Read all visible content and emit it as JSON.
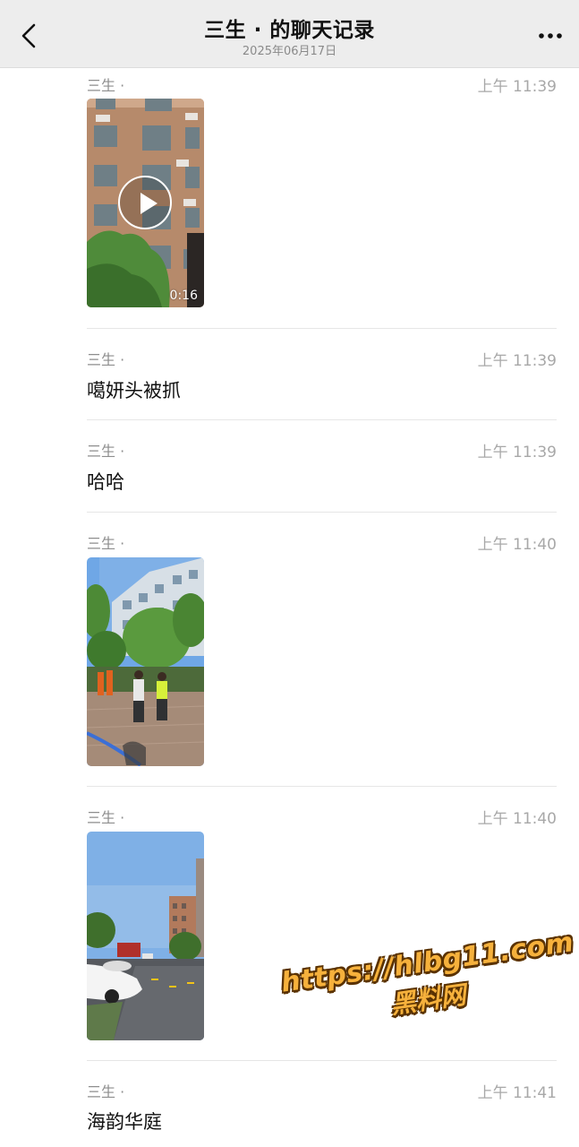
{
  "header": {
    "title": "三生 · 的聊天记录",
    "date": "2025年06月17日",
    "back_icon": "chevron-left-icon",
    "more_icon": "more-dots-icon"
  },
  "messages": [
    {
      "sender": "三生 ·",
      "time": "上午 11:39",
      "type": "video",
      "duration": "0:16"
    },
    {
      "sender": "三生 ·",
      "time": "上午 11:39",
      "type": "text",
      "text": "噶妍头被抓"
    },
    {
      "sender": "三生 ·",
      "time": "上午 11:39",
      "type": "text",
      "text": "哈哈"
    },
    {
      "sender": "三生 ·",
      "time": "上午 11:40",
      "type": "image"
    },
    {
      "sender": "三生 ·",
      "time": "上午 11:40",
      "type": "image"
    },
    {
      "sender": "三生 ·",
      "time": "上午 11:41",
      "type": "text",
      "text": "海韵华庭"
    }
  ],
  "watermark": {
    "url": "https://hlbg11.com",
    "name": "黑料网"
  },
  "colors": {
    "header_bg": "#ededed",
    "meta_text": "#a8a8a8",
    "watermark": "#f6b13c"
  }
}
